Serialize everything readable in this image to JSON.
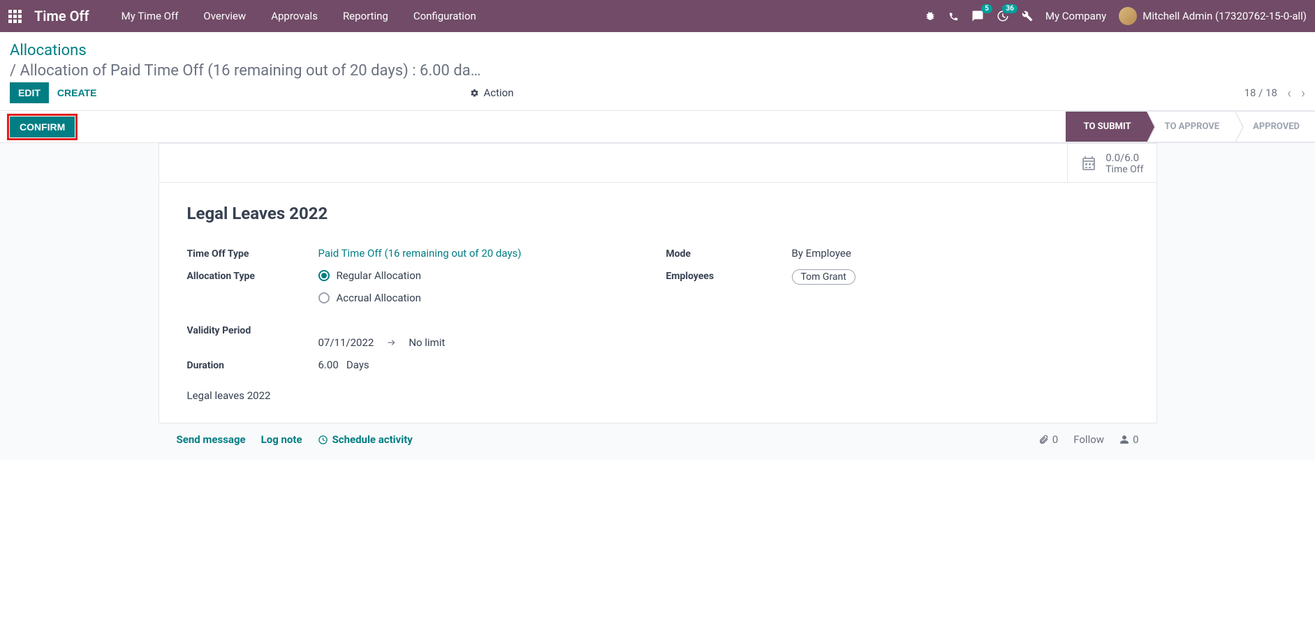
{
  "nav": {
    "app_name": "Time Off",
    "menu": [
      "My Time Off",
      "Overview",
      "Approvals",
      "Reporting",
      "Configuration"
    ],
    "messaging_badge": "5",
    "activities_badge": "36",
    "company": "My Company",
    "user": "Mitchell Admin (17320762-15-0-all)"
  },
  "breadcrumb": {
    "root": "Allocations",
    "leaf": "/ Allocation of Paid Time Off (16 remaining out of 20 days) : 6.00 da…"
  },
  "controlbar": {
    "edit": "EDIT",
    "create": "CREATE",
    "action": "Action",
    "pager": "18 / 18"
  },
  "statusbar": {
    "confirm": "CONFIRM",
    "steps": [
      "TO SUBMIT",
      "TO APPROVE",
      "APPROVED"
    ],
    "active_index": 0
  },
  "statbox": {
    "value": "0.0/6.0",
    "label": "Time Off"
  },
  "form": {
    "title": "Legal Leaves 2022",
    "labels": {
      "time_off_type": "Time Off Type",
      "allocation_type": "Allocation Type",
      "validity_period": "Validity Period",
      "duration": "Duration",
      "mode": "Mode",
      "employees": "Employees"
    },
    "time_off_type_value": "Paid Time Off (16 remaining out of 20 days)",
    "allocation_regular": "Regular Allocation",
    "allocation_accrual": "Accrual Allocation",
    "validity_from": "07/11/2022",
    "validity_to": "No limit",
    "duration_value": "6.00",
    "duration_unit": "Days",
    "mode_value": "By Employee",
    "employee_tag": "Tom Grant",
    "note": "Legal leaves 2022"
  },
  "chatter": {
    "send": "Send message",
    "log": "Log note",
    "schedule": "Schedule activity",
    "attach_count": "0",
    "follow": "Follow",
    "follower_count": "0"
  }
}
